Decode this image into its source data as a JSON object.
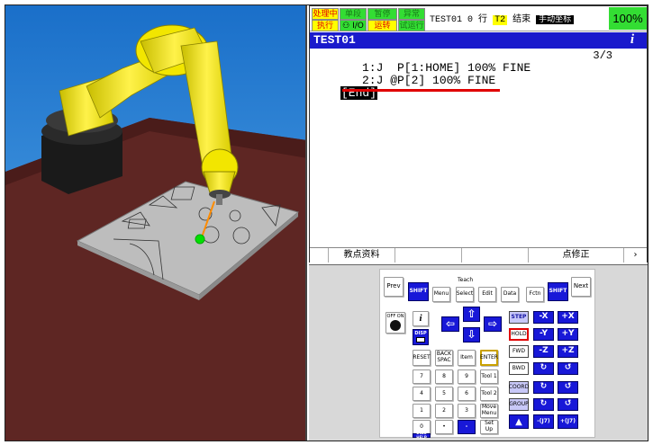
{
  "status": {
    "processing": "处理中",
    "single_step": "单段",
    "pause": "暂停",
    "fault": "异常",
    "executing": "执行",
    "io": "I/O",
    "running": "运转",
    "test": "试运行",
    "program": "TEST01",
    "line_label": "0 行",
    "t2": "T2",
    "state": "结束",
    "mode": "手动坐标",
    "override": "100%"
  },
  "screen": {
    "title": "TEST01",
    "info_icon": "i",
    "line_count": "3/3",
    "lines": [
      "1:J  P[1:HOME] 100% FINE",
      "2:J @P[2] 100% FINE"
    ],
    "end": "[End]"
  },
  "function_keys": [
    "教点资料",
    "",
    "",
    "点修正",
    "›"
  ],
  "keypad": {
    "prev": "Prev",
    "shift_left": "SHIFT",
    "teach": "Teach",
    "menu": "Menu",
    "select": "Select",
    "edit": "Edit",
    "data": "Data",
    "fctn": "Fctn",
    "shift_right": "SHIFT",
    "next": "Next",
    "onoff": "OFF ON",
    "info": "i",
    "disp": "DISP",
    "reset": "RESET",
    "backspace": "BACK SPAC",
    "item": "Item",
    "enter": "ENTER",
    "step": "STEP",
    "hold": "HOLD",
    "fwd": "FWD",
    "bwd": "BWD",
    "coord": "COORD",
    "group": "GROUP",
    "num7": "7",
    "num8": "8",
    "num9": "9",
    "num4": "4",
    "num5": "5",
    "num6": "6",
    "num1": "1",
    "num2": "2",
    "num3": "3",
    "num0": "0",
    "dot": "•",
    "comma": "-",
    "tool1": "Tool 1",
    "tool2": "Tool 2",
    "move_menu": "Move Menu",
    "setup": "Set Up",
    "status": "Status",
    "diag": "DIAG HELP",
    "posn": "Posn",
    "io": "I/O",
    "jog_minus_x": "-X",
    "jog_plus_x": "+X",
    "jog_minus_y": "-Y",
    "jog_plus_y": "+Y",
    "jog_minus_z": "-Z",
    "jog_plus_z": "+Z",
    "jog_minus_j7": "-(J7)",
    "jog_plus_j7": "+(J7)",
    "jog_minus_j8": "-(J8)",
    "jog_plus_j8": "+(J8)"
  },
  "colors": {
    "pendant_blue": "#1a1acc",
    "status_green": "#33dd33",
    "status_yellow": "#ffff00",
    "robot_yellow": "#f2e600",
    "base_red": "#6a2a26",
    "highlight_red": "#e00000"
  }
}
